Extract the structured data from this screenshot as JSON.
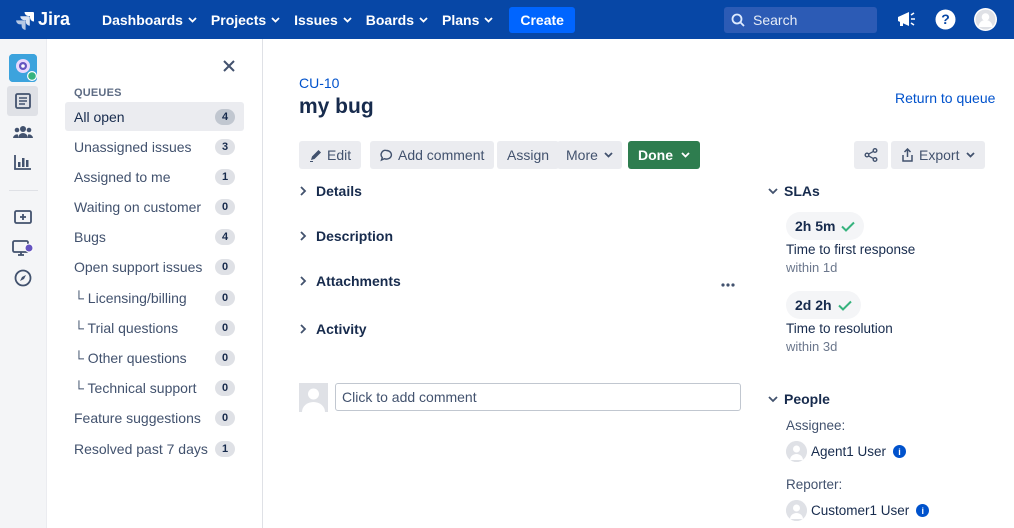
{
  "nav": {
    "logo_text": "Jira",
    "items": [
      {
        "label": "Dashboards"
      },
      {
        "label": "Projects"
      },
      {
        "label": "Issues"
      },
      {
        "label": "Boards"
      },
      {
        "label": "Plans"
      }
    ],
    "create_label": "Create",
    "search_placeholder": "Search",
    "colors": {
      "nav_bg": "#0747A6",
      "create_bg": "#0065FF"
    }
  },
  "rail": {
    "icons": [
      "project-avatar-icon",
      "queues-icon",
      "customers-icon",
      "reports-icon",
      "raise-request-icon",
      "channels-icon",
      "explore-icon"
    ]
  },
  "queues": {
    "header": "QUEUES",
    "items": [
      {
        "label": "All open",
        "count": "4",
        "active": true
      },
      {
        "label": "Unassigned issues",
        "count": "3"
      },
      {
        "label": "Assigned to me",
        "count": "1"
      },
      {
        "label": "Waiting on customer",
        "count": "0"
      },
      {
        "label": "Bugs",
        "count": "4"
      },
      {
        "label": "Open support issues",
        "count": "0"
      },
      {
        "label": "└ Licensing/billing",
        "count": "0"
      },
      {
        "label": "└ Trial questions",
        "count": "0"
      },
      {
        "label": "└ Other questions",
        "count": "0"
      },
      {
        "label": "└ Technical support",
        "count": "0"
      },
      {
        "label": "Feature suggestions",
        "count": "0"
      },
      {
        "label": "Resolved past 7 days",
        "count": "1"
      }
    ]
  },
  "issue": {
    "key": "CU-10",
    "title": "my bug",
    "return_label": "Return to queue",
    "actions": {
      "edit": "Edit",
      "add_comment": "Add comment",
      "assign": "Assign",
      "more": "More",
      "status": "Done",
      "export": "Export"
    },
    "sections": [
      "Details",
      "Description",
      "Attachments",
      "Activity"
    ],
    "comment_placeholder": "Click to add comment"
  },
  "sla": {
    "header": "SLAs",
    "items": [
      {
        "time": "2h 5m",
        "label": "Time to first response",
        "sub": "within 1d"
      },
      {
        "time": "2d 2h",
        "label": "Time to resolution",
        "sub": "within 3d"
      }
    ]
  },
  "people": {
    "header": "People",
    "assignee_label": "Assignee:",
    "assignee": "Agent1 User",
    "reporter_label": "Reporter:",
    "reporter": "Customer1 User"
  }
}
